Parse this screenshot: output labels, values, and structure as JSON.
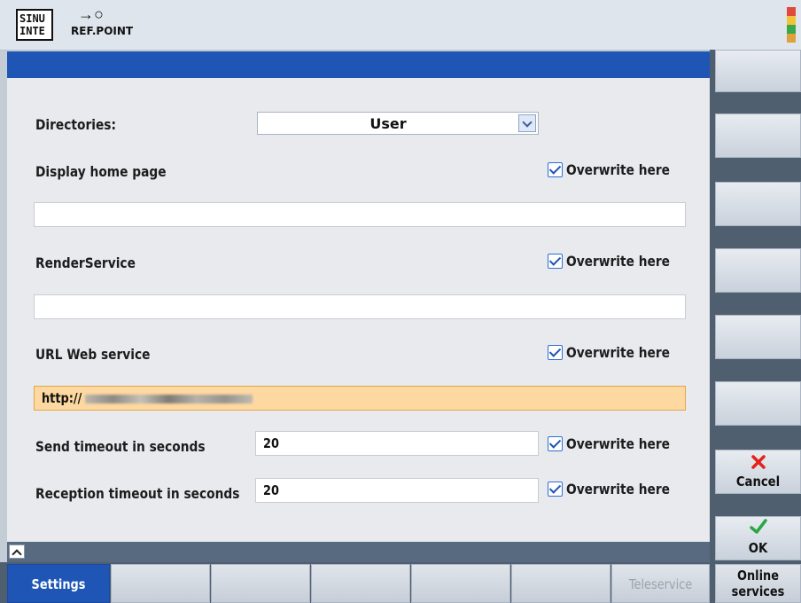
{
  "header": {
    "logo_text": "SINU INTE",
    "refpoint_label": "REF.POINT"
  },
  "form": {
    "directories": {
      "label": "Directories:",
      "value": "User"
    },
    "home_page": {
      "label": "Display home page",
      "overwrite_label": "Overwrite here",
      "overwrite_checked": true,
      "value": ""
    },
    "render_service": {
      "label": "RenderService",
      "overwrite_label": "Overwrite here",
      "overwrite_checked": true,
      "value": ""
    },
    "url_web_service": {
      "label": "URL Web service",
      "overwrite_label": "Overwrite here",
      "overwrite_checked": true,
      "value_prefix": "http://"
    },
    "send_timeout": {
      "label": "Send timeout in seconds",
      "value": "20",
      "overwrite_label": "Overwrite here",
      "overwrite_checked": true
    },
    "reception_timeout": {
      "label": "Reception timeout in seconds",
      "value": "20",
      "overwrite_label": "Overwrite here",
      "overwrite_checked": true
    }
  },
  "softkeys": {
    "cancel_label": "Cancel",
    "ok_label": "OK"
  },
  "bottom_tabs": {
    "settings": "Settings",
    "teleservice": "Teleservice",
    "online_services": "Online services"
  },
  "colors": {
    "accent_blue": "#1f56b6",
    "highlight_field": "#fdd8a0",
    "cancel_red": "#e2231a",
    "ok_green": "#28a745"
  }
}
